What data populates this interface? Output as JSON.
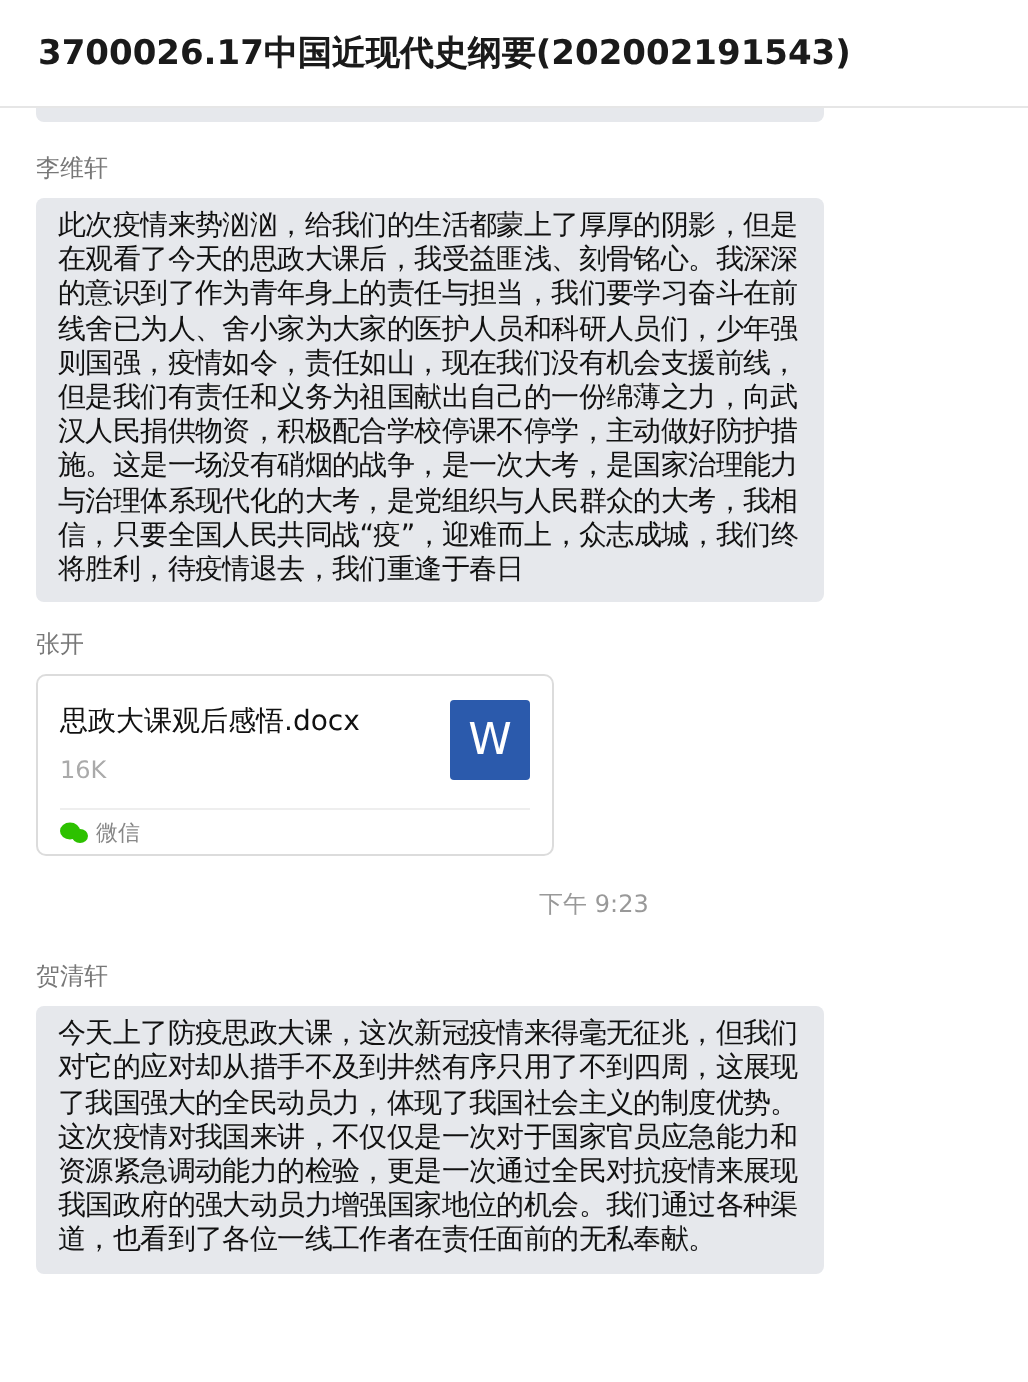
{
  "window": {
    "title": "3700026.17中国近现代史纲要(202002191543)"
  },
  "messages": [
    {
      "kind": "text",
      "sender": "李维轩",
      "text": "此次疫情来势汹汹，给我们的生活都蒙上了厚厚的阴影，但是在观看了今天的思政大课后，我受益匪浅、刻骨铭心。我深深的意识到了作为青年身上的责任与担当，我们要学习奋斗在前线舍已为人、舍小家为大家的医护人员和科研人员们，少年强则国强，疫情如令，责任如山，现在我们没有机会支援前线，但是我们有责任和义务为祖国献出自己的一份绵薄之力，向武汉人民捐供物资，积极配合学校停课不停学，主动做好防护措施。这是一场没有硝烟的战争，是一次大考，是国家治理能力与治理体系现代化的大考，是党组织与人民群众的大考，我相信，只要全国人民共同战“疫”，迎难而上，众志成城，我们终将胜利，待疫情退去，我们重逢于春日"
    },
    {
      "kind": "file",
      "sender": "张开",
      "file_name": "思政大课观后感悟.docx",
      "file_size": "16K",
      "file_icon": "W",
      "source": "微信"
    },
    {
      "kind": "time",
      "text": "下午 9:23"
    },
    {
      "kind": "text",
      "sender": "贺清轩",
      "text": "今天上了防疫思政大课，这次新冠疫情来得毫无征兆，但我们对它的应对却从措手不及到井然有序只用了不到四周，这展现了我国强大的全民动员力，体现了我国社会主义的制度优势。这次疫情对我国来讲，不仅仅是一次对于国家官员应急能力和资源紧急调动能力的检验，更是一次通过全民对抗疫情来展现我国政府的强大动员力增强国家地位的机会。我们通过各种渠道，也看到了各位一线工作者在责任面前的无私奉献。"
    }
  ]
}
